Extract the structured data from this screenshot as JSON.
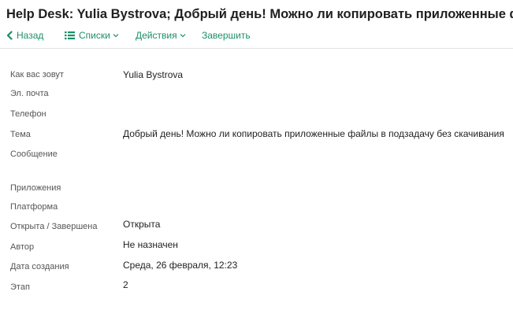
{
  "title": "Help Desk: Yulia Bystrova; Добрый день! Можно ли копировать приложенные файлы в подзадачу без скачивания",
  "toolbar": {
    "back_label": "Назад",
    "lists_label": "Списки",
    "actions_label": "Действия",
    "finish_label": "Завершить",
    "accent_color": "#1a8f6a"
  },
  "icons": {
    "back": "chevron-left-icon",
    "lists": "list-icon",
    "dropdown": "caret-down-icon"
  },
  "fields": [
    {
      "label": "Как вас зовут",
      "value": "Yulia Bystrova"
    },
    {
      "label": "Эл. почта",
      "value": ""
    },
    {
      "label": "Телефон",
      "value": ""
    },
    {
      "label": "Тема",
      "value": "Добрый день! Можно ли копировать приложенные файлы в подзадачу без скачивания"
    },
    {
      "label": "Сообщение",
      "value": ""
    },
    {
      "label": "Приложения",
      "value": ""
    },
    {
      "label": "Платформа",
      "value": ""
    },
    {
      "label": "Открыта / Завершена",
      "value": "Открыта"
    },
    {
      "label": "Автор",
      "value": "Не назначен"
    },
    {
      "label": "Дата создания",
      "value": "Среда, 26 февраля, 12:23"
    },
    {
      "label": "Этап",
      "value": "2"
    }
  ]
}
